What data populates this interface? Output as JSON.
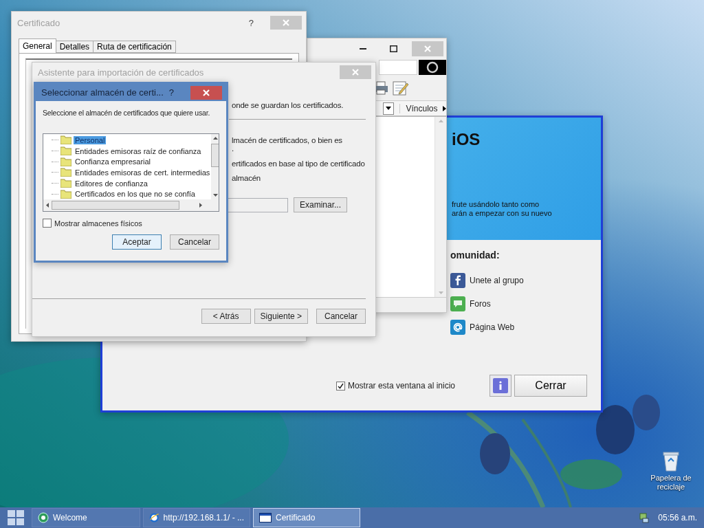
{
  "desktop": {
    "icons": [
      {
        "label": "Papelera de reciclaje",
        "kind": "recycle"
      }
    ]
  },
  "welcome_window": {
    "heading": "iOS",
    "intro_lines": [
      "frute usándolo tanto como",
      "arán a empezar con su nuevo"
    ],
    "community_heading": "omunidad:",
    "links": [
      {
        "label": "Unete al grupo",
        "kind": "facebook"
      },
      {
        "label": "Foros",
        "kind": "forum"
      },
      {
        "label": "Página Web",
        "kind": "web"
      }
    ],
    "show_at_startup": {
      "label": "Mostrar esta ventana al inicio",
      "checked": true
    },
    "close_button": "Cerrar"
  },
  "browser_window": {
    "links_label": "Vínculos"
  },
  "certificate_window": {
    "title": "Certificado",
    "help": "?",
    "tabs": [
      {
        "label": "General",
        "selected": true
      },
      {
        "label": "Detalles",
        "selected": false
      },
      {
        "label": "Ruta de certificación",
        "selected": false
      }
    ]
  },
  "import_wizard": {
    "title": "Asistente para importación de certificados",
    "intro": "onde se guardan los certificados.",
    "lines": [
      "lmacén de certificados, o bien es",
      ".",
      "ertificados en base al tipo de certificado",
      "almacén"
    ],
    "browse_button": "Examinar...",
    "buttons": [
      "< Atrás",
      "Siguiente >",
      "Cancelar"
    ]
  },
  "store_dialog": {
    "title": "Seleccionar almacén de certi...",
    "help": "?",
    "prompt": "Seleccione el almacén de certificados que quiere usar.",
    "stores": [
      {
        "label": "Personal",
        "selected": true
      },
      {
        "label": "Entidades emisoras raíz de confianza",
        "selected": false
      },
      {
        "label": "Confianza empresarial",
        "selected": false
      },
      {
        "label": "Entidades emisoras de cert. intermedias",
        "selected": false
      },
      {
        "label": "Editores de confianza",
        "selected": false
      },
      {
        "label": "Certificados en los que no se confía",
        "selected": false
      }
    ],
    "show_physical": {
      "label": "Mostrar almacenes físicos",
      "checked": false
    },
    "buttons": [
      "Aceptar",
      "Cancelar"
    ]
  },
  "taskbar": {
    "items": [
      {
        "label": "Welcome",
        "kind": "welcome",
        "selected": false
      },
      {
        "label": "http://192.168.1.1/ - ...",
        "kind": "browser",
        "selected": false
      },
      {
        "label": "Certificado",
        "kind": "window",
        "selected": true
      }
    ],
    "clock": "05:56 a.m."
  }
}
